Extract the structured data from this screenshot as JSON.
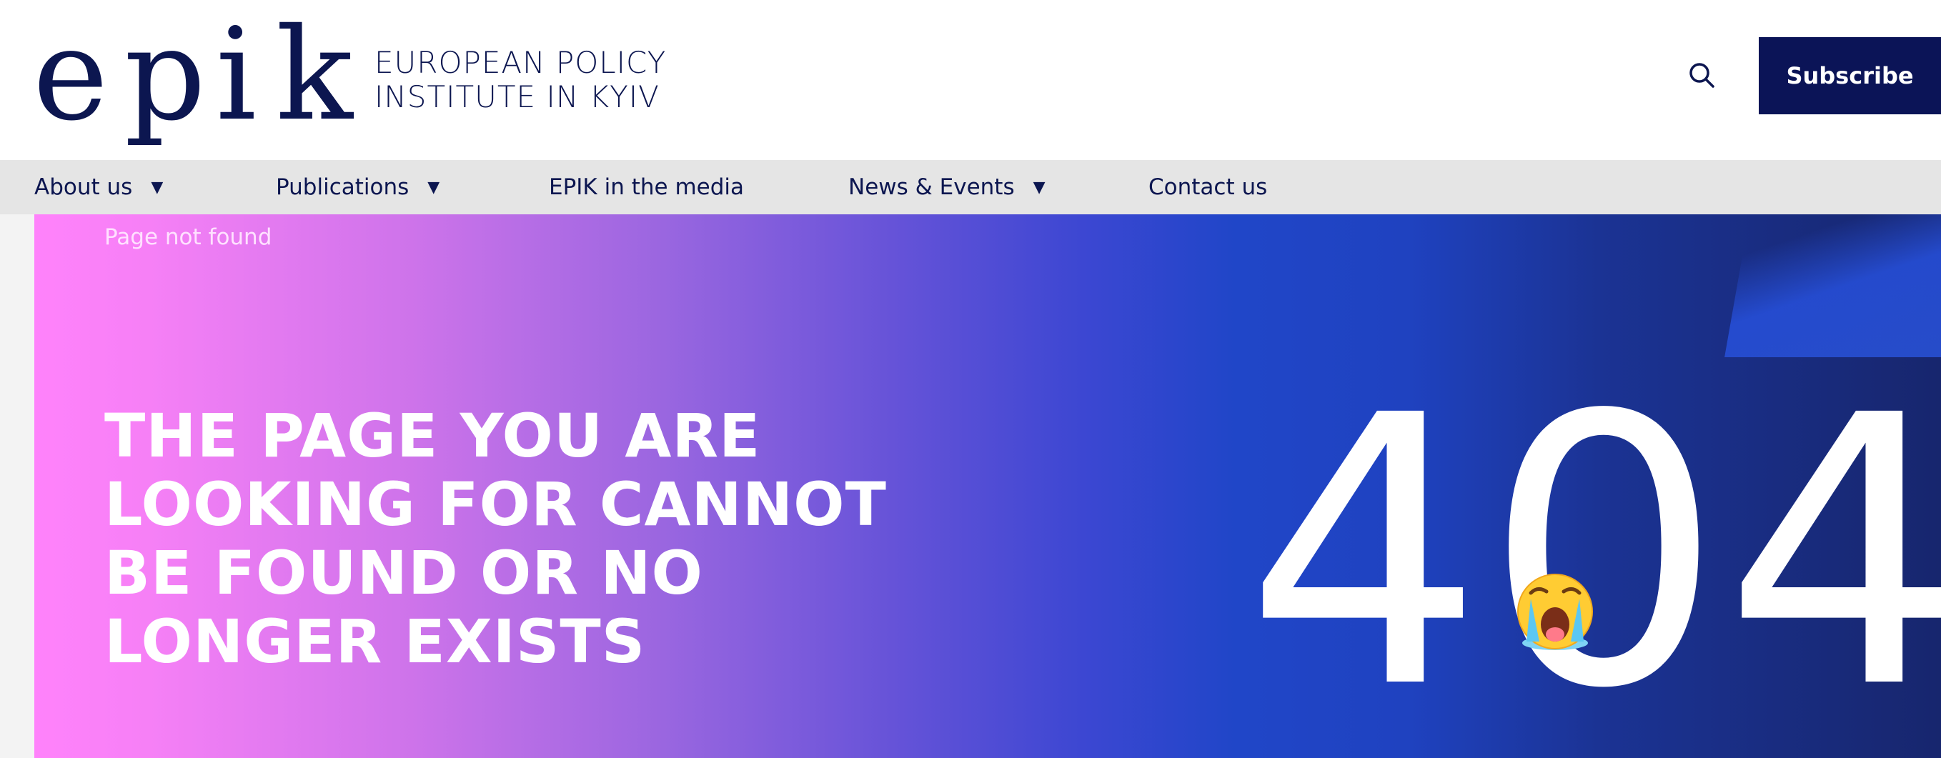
{
  "header": {
    "logo_letters": [
      "e",
      "p",
      "i",
      "k"
    ],
    "tagline_line1": "EUROPEAN POLICY",
    "tagline_line2": "INSTITUTE IN KYIV",
    "search_icon": "search-icon",
    "subscribe_label": "Subscribe"
  },
  "nav": {
    "items": [
      {
        "label": "About us",
        "dropdown": true
      },
      {
        "label": "Publications",
        "dropdown": true
      },
      {
        "label": "EPIK in the media",
        "dropdown": false
      },
      {
        "label": "News & Events",
        "dropdown": true
      },
      {
        "label": "Contact us",
        "dropdown": false
      }
    ],
    "caret": "▼"
  },
  "hero": {
    "breadcrumb": "Page not found",
    "headline_lines": [
      "THE PAGE YOU ARE",
      "LOOKING FOR CANNOT",
      "BE FOUND OR NO",
      "LONGER EXISTS"
    ],
    "code": "404",
    "emoji_icon": "loudly-crying-face-icon"
  },
  "colors": {
    "brand_navy": "#0b1457",
    "nav_bg": "#e5e5e5",
    "gradient_start": "#ff82fb",
    "gradient_end": "#17266e"
  }
}
